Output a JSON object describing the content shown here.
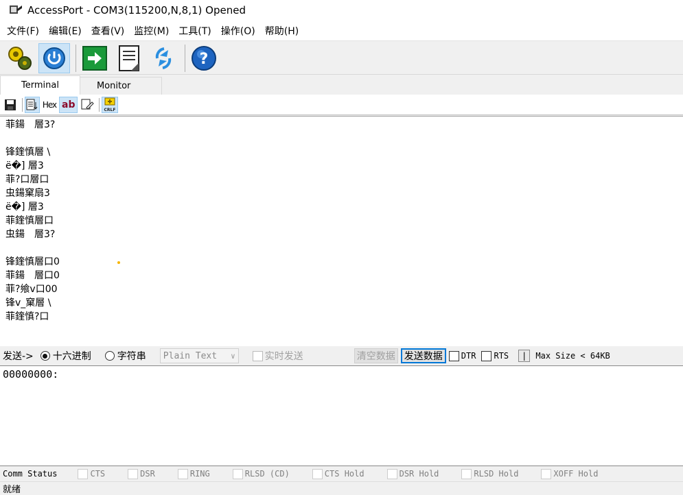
{
  "window": {
    "title": "AccessPort - COM3(115200,N,8,1) Opened"
  },
  "menu": [
    "文件(F)",
    "编辑(E)",
    "查看(V)",
    "监控(M)",
    "工具(T)",
    "操作(O)",
    "帮助(H)"
  ],
  "tabs": {
    "terminal": "Terminal",
    "monitor": "Monitor"
  },
  "subtoolbar": {
    "hex_label": "Hex",
    "ab_label": "ab",
    "crlf_label": "CRLF"
  },
  "terminal_lines": [
    "菲鍚　層3?",
    "",
    "锋鍷慎層 \\",
    "ё�] 層3",
    "菲?口層口",
    "虫鍚窠扇3",
    "ё�] 層3",
    "菲鍷慎層口",
    "虫鍚　層3?",
    "",
    "锋鍷慎層口0",
    "菲鍚　層口0",
    "菲?飨v口00",
    "锋v_窠層 \\",
    "菲鍷慎?口"
  ],
  "send_bar": {
    "label": "发送->",
    "radio_hex": "十六进制",
    "radio_string": "字符串",
    "format_value": "Plain Text",
    "realtime_label": "实时发送",
    "clear_label": "清空数据",
    "send_label": "发送数据",
    "dtr_label": "DTR",
    "rts_label": "RTS",
    "pipe_label": "|",
    "max_size": "Max Size < 64KB"
  },
  "send_area": {
    "content": "00000000:"
  },
  "comm_status": {
    "label": "Comm Status",
    "items": [
      "CTS",
      "DSR",
      "RING",
      "RLSD (CD)",
      "CTS Hold",
      "DSR Hold",
      "RLSD Hold",
      "XOFF Hold"
    ]
  },
  "status_text": "就绪",
  "colors": {
    "accent": "#0078d7",
    "selection": "#cce4f7"
  },
  "icons": [
    "gear-icon",
    "power-icon",
    "arrow-right-icon",
    "document-icon",
    "refresh-icon",
    "help-icon",
    "save-icon",
    "hex-icon",
    "ab-icon",
    "edit-icon",
    "crlf-icon"
  ]
}
